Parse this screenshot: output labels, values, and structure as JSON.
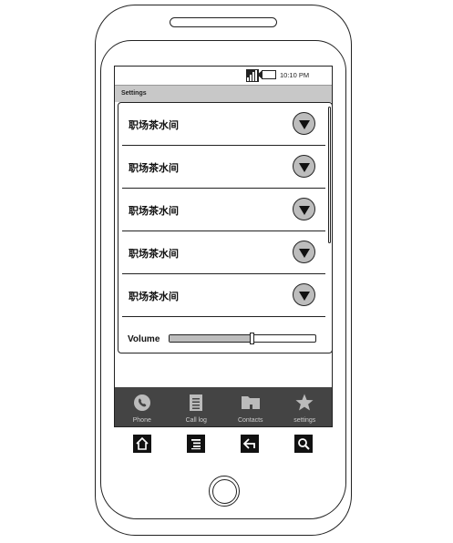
{
  "status": {
    "time": "10:10 PM"
  },
  "header": {
    "title": "Settings"
  },
  "settings": {
    "rows": [
      {
        "label": "职场茶水间"
      },
      {
        "label": "职场茶水间"
      },
      {
        "label": "职场茶水间"
      },
      {
        "label": "职场茶水间"
      },
      {
        "label": "职场茶水间"
      }
    ],
    "volume": {
      "label": "Volume",
      "level": 0.56
    }
  },
  "bottom_nav": {
    "items": [
      {
        "label": "Phone",
        "icon": "phone-icon"
      },
      {
        "label": "Call log",
        "icon": "document-icon"
      },
      {
        "label": "Contacts",
        "icon": "folder-icon"
      },
      {
        "label": "settings",
        "icon": "star-icon"
      }
    ]
  },
  "hardware_keys": [
    {
      "icon": "home-icon"
    },
    {
      "icon": "menu-icon"
    },
    {
      "icon": "back-icon"
    },
    {
      "icon": "search-icon"
    }
  ],
  "colors": {
    "nav_bg": "#444444",
    "title_bg": "#c8c8c8",
    "accent": "#bdbdbd"
  }
}
